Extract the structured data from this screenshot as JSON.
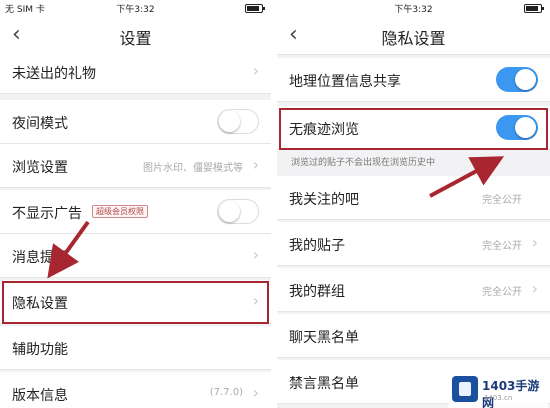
{
  "left": {
    "status": {
      "carrier": "无 SIM 卡",
      "time": "下午3:32"
    },
    "nav": {
      "back": "‹",
      "title": "设置"
    },
    "rows": [
      {
        "label": "未送出的礼物"
      },
      {
        "label": "夜间模式"
      },
      {
        "label": "浏览设置",
        "value": "图片水印、僵婴模式等"
      },
      {
        "label": "不显示广告",
        "tag": "超级会员权限"
      },
      {
        "label": "消息提醒"
      },
      {
        "label": "隐私设置"
      },
      {
        "label": "辅助功能"
      },
      {
        "label": "版本信息",
        "value": "(7.7.0)"
      }
    ]
  },
  "right": {
    "status": {
      "carrier": "",
      "time": "下午3:32"
    },
    "nav": {
      "back": "‹",
      "title": "隐私设置"
    },
    "rows": [
      {
        "label": "地理位置信息共享"
      },
      {
        "label": "无痕迹浏览"
      },
      {
        "label": "我关注的吧",
        "value": "完全公开"
      },
      {
        "label": "我的贴子",
        "value": "完全公开"
      },
      {
        "label": "我的群组",
        "value": "完全公开"
      },
      {
        "label": "聊天黑名单"
      },
      {
        "label": "禁言黑名单"
      }
    ],
    "hint": "浏览过的贴子不会出现在浏览历史中"
  },
  "toggles": {
    "night_mode": false,
    "hide_ads": false,
    "location_share": true,
    "traceless_browse": true
  },
  "colors": {
    "accent": "#3b97f0",
    "highlight": "#a8262f"
  },
  "watermark": {
    "text": "1403手游网",
    "sub": "1403.cn"
  }
}
